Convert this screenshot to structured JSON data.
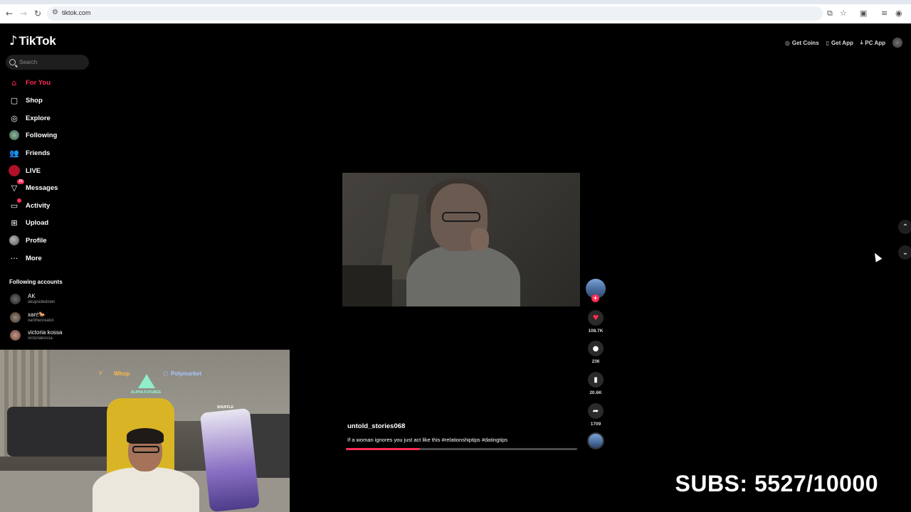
{
  "browser": {
    "url": "tiktok.com",
    "back_icon": "arrow-left-icon",
    "forward_icon": "arrow-right-icon",
    "reload_icon": "reload-icon"
  },
  "sidebar": {
    "brand": "TikTok",
    "search_placeholder": "Search",
    "items": [
      {
        "label": "For You",
        "icon": "home-icon",
        "active": true
      },
      {
        "label": "Shop",
        "icon": "shop-icon"
      },
      {
        "label": "Explore",
        "icon": "compass-icon"
      },
      {
        "label": "Following",
        "icon": "following-avatar-icon"
      },
      {
        "label": "Friends",
        "icon": "friends-icon"
      },
      {
        "label": "LIVE",
        "icon": "live-icon"
      },
      {
        "label": "Messages",
        "icon": "send-icon",
        "badge": "21"
      },
      {
        "label": "Activity",
        "icon": "inbox-icon",
        "dot": true
      },
      {
        "label": "Upload",
        "icon": "plus-square-icon"
      },
      {
        "label": "Profile",
        "icon": "profile-avatar-icon"
      },
      {
        "label": "More",
        "icon": "more-dots-icon"
      }
    ],
    "following_title": "Following accounts",
    "accounts": [
      {
        "name": "AK",
        "username": "akupsidedown"
      },
      {
        "name": "xan🕯🐎",
        "username": "xanthecreator"
      },
      {
        "name": "victoria kossa",
        "username": "victoriakossa"
      }
    ]
  },
  "topbar": {
    "get_coins": "Get Coins",
    "get_app": "Get App",
    "pc_app": "PC App"
  },
  "video": {
    "creator": "untold_stories068",
    "caption": "If a woman ignores you just act like this #relationshiptips #datingtips",
    "progress": 0.32,
    "likes": "108.7K",
    "comments": "236",
    "saves": "20.6K",
    "shares": "1709"
  },
  "overlay": {
    "subs": "SUBS: 5527/10000",
    "neon_whop": "Whop",
    "neon_poly": "Polymarket",
    "neon_alpha": "ALPHA FUTURES",
    "neon_shuffle": "SHUFFLE"
  },
  "colors": {
    "accent": "#fe2c55",
    "background": "#000000"
  }
}
